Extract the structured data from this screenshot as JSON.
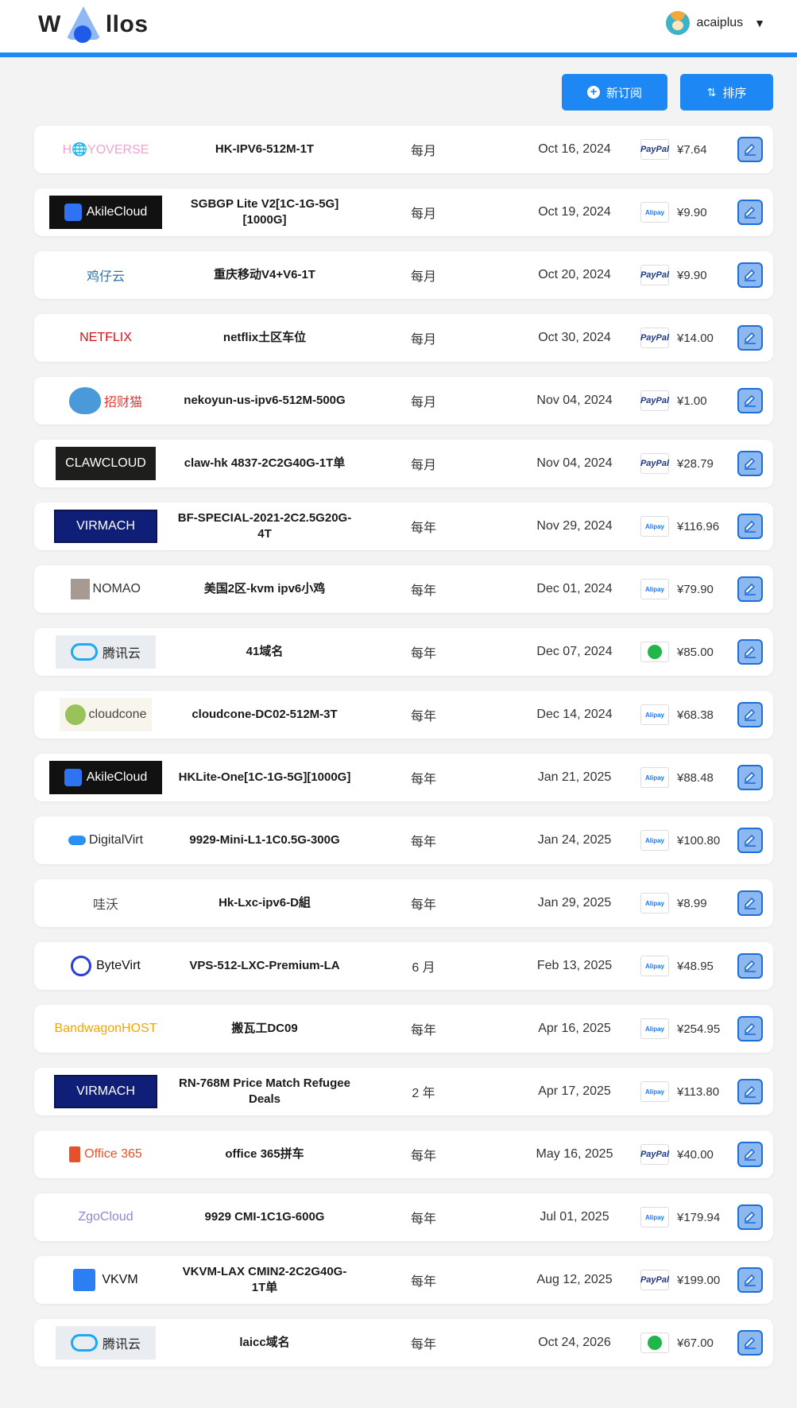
{
  "header": {
    "logo_left": "W",
    "logo_right": "llos",
    "username": "acaiplus",
    "caret": "▼"
  },
  "toolbar": {
    "new_label": "新订阅",
    "sort_label": "排序"
  },
  "colors": {
    "accent": "#1d87f4",
    "edit_bg": "#8cb8ef",
    "edit_border": "#1c6fd8"
  },
  "rows": [
    {
      "logo": "H🌐YOVERSE",
      "logo_style": "hoyo",
      "name": "HK-IPV6-512M-1T",
      "cycle": "每月",
      "date": "Oct 16, 2024",
      "payment": "paypal",
      "price": "¥7.64"
    },
    {
      "logo": "AkileCloud",
      "logo_style": "akile",
      "name": "SGBGP Lite V2[1C-1G-5G][1000G]",
      "cycle": "每月",
      "date": "Oct 19, 2024",
      "payment": "alipay",
      "price": "¥9.90"
    },
    {
      "logo": "鸡仔云",
      "logo_style": "jizai",
      "name": "重庆移动V4+V6-1T",
      "cycle": "每月",
      "date": "Oct 20, 2024",
      "payment": "paypal",
      "price": "¥9.90"
    },
    {
      "logo": "NETFLIX",
      "logo_style": "netflix",
      "name": "netflix土区车位",
      "cycle": "每月",
      "date": "Oct 30, 2024",
      "payment": "paypal",
      "price": "¥14.00"
    },
    {
      "logo": "招财猫",
      "logo_style": "zhaocai",
      "name": "nekoyun-us-ipv6-512M-500G",
      "cycle": "每月",
      "date": "Nov 04, 2024",
      "payment": "paypal",
      "price": "¥1.00"
    },
    {
      "logo": "CLAWCLOUD",
      "logo_style": "claw",
      "name": "claw-hk 4837-2C2G40G-1T单",
      "cycle": "每月",
      "date": "Nov 04, 2024",
      "payment": "paypal",
      "price": "¥28.79"
    },
    {
      "logo": "VIRMACH",
      "logo_style": "virmach",
      "name": "BF-SPECIAL-2021-2C2.5G20G-4T",
      "cycle": "每年",
      "date": "Nov 29, 2024",
      "payment": "alipay",
      "price": "¥116.96"
    },
    {
      "logo": "NOMAO",
      "logo_style": "nomao",
      "name": "美国2区-kvm ipv6小鸡",
      "cycle": "每年",
      "date": "Dec 01, 2024",
      "payment": "alipay",
      "price": "¥79.90"
    },
    {
      "logo": "腾讯云",
      "logo_style": "tencent",
      "name": "41域名",
      "cycle": "每年",
      "date": "Dec 07, 2024",
      "payment": "wechat",
      "price": "¥85.00"
    },
    {
      "logo": "cloudcone",
      "logo_style": "cloudcone",
      "name": "cloudcone-DC02-512M-3T",
      "cycle": "每年",
      "date": "Dec 14, 2024",
      "payment": "alipay",
      "price": "¥68.38"
    },
    {
      "logo": "AkileCloud",
      "logo_style": "akile",
      "name": "HKLite-One[1C-1G-5G][1000G]",
      "cycle": "每年",
      "date": "Jan 21, 2025",
      "payment": "alipay",
      "price": "¥88.48"
    },
    {
      "logo": "DigitalVirt",
      "logo_style": "digitalvirt",
      "name": "9929-Mini-L1-1C0.5G-300G",
      "cycle": "每年",
      "date": "Jan 24, 2025",
      "payment": "alipay",
      "price": "¥100.80"
    },
    {
      "logo": "哇沃",
      "logo_style": "wawo",
      "name": "Hk-Lxc-ipv6-D組",
      "cycle": "每年",
      "date": "Jan 29, 2025",
      "payment": "alipay",
      "price": "¥8.99"
    },
    {
      "logo": "ByteVirt",
      "logo_style": "bytevirt",
      "name": "VPS-512-LXC-Premium-LA",
      "cycle": "6 月",
      "date": "Feb 13, 2025",
      "payment": "alipay",
      "price": "¥48.95"
    },
    {
      "logo": "BandwagonHOST",
      "logo_style": "bandwagon",
      "name": "搬瓦工DC09",
      "cycle": "每年",
      "date": "Apr 16, 2025",
      "payment": "alipay",
      "price": "¥254.95"
    },
    {
      "logo": "VIRMACH",
      "logo_style": "virmach",
      "name": "RN-768M Price Match Refugee Deals",
      "cycle": "2 年",
      "date": "Apr 17, 2025",
      "payment": "alipay",
      "price": "¥113.80"
    },
    {
      "logo": "Office 365",
      "logo_style": "office",
      "name": "office 365拼车",
      "cycle": "每年",
      "date": "May 16, 2025",
      "payment": "paypal",
      "price": "¥40.00"
    },
    {
      "logo": "ZgoCloud",
      "logo_style": "zgo",
      "name": "9929 CMI-1C1G-600G",
      "cycle": "每年",
      "date": "Jul 01, 2025",
      "payment": "alipay",
      "price": "¥179.94"
    },
    {
      "logo": "VKVM",
      "logo_style": "vkvm",
      "name": "VKVM-LAX CMIN2-2C2G40G-1T单",
      "cycle": "每年",
      "date": "Aug 12, 2025",
      "payment": "paypal",
      "price": "¥199.00"
    },
    {
      "logo": "腾讯云",
      "logo_style": "tencent",
      "name": "laicc域名",
      "cycle": "每年",
      "date": "Oct 24, 2026",
      "payment": "wechat",
      "price": "¥67.00"
    }
  ],
  "payment_labels": {
    "paypal": "PayPal",
    "alipay": "Alipay"
  }
}
